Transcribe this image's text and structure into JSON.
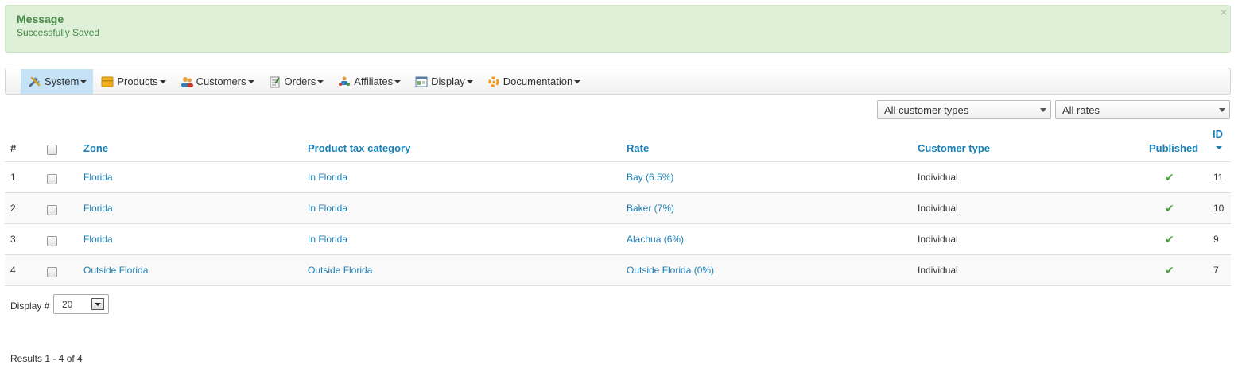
{
  "message": {
    "heading": "Message",
    "text": "Successfully Saved",
    "close": "×"
  },
  "menu": [
    {
      "label": "System",
      "icon": "tools-icon",
      "active": true
    },
    {
      "label": "Products",
      "icon": "box-icon"
    },
    {
      "label": "Customers",
      "icon": "users-icon"
    },
    {
      "label": "Orders",
      "icon": "orders-icon"
    },
    {
      "label": "Affiliates",
      "icon": "affiliates-icon"
    },
    {
      "label": "Display",
      "icon": "display-icon"
    },
    {
      "label": "Documentation",
      "icon": "documentation-icon"
    }
  ],
  "filters": {
    "customer_type": "All customer types",
    "rates": "All rates"
  },
  "table": {
    "headers": {
      "num": "#",
      "zone": "Zone",
      "product_tax_category": "Product tax category",
      "rate": "Rate",
      "customer_type": "Customer type",
      "published": "Published",
      "id": "ID"
    },
    "rows": [
      {
        "num": "1",
        "zone": "Florida",
        "category": "In Florida",
        "rate": "Bay (6.5%)",
        "customer_type": "Individual",
        "published": "✔",
        "id": "11"
      },
      {
        "num": "2",
        "zone": "Florida",
        "category": "In Florida",
        "rate": "Baker (7%)",
        "customer_type": "Individual",
        "published": "✔",
        "id": "10"
      },
      {
        "num": "3",
        "zone": "Florida",
        "category": "In Florida",
        "rate": "Alachua (6%)",
        "customer_type": "Individual",
        "published": "✔",
        "id": "9"
      },
      {
        "num": "4",
        "zone": "Outside Florida",
        "category": "Outside Florida",
        "rate": "Outside Florida (0%)",
        "customer_type": "Individual",
        "published": "✔",
        "id": "7"
      }
    ]
  },
  "footer": {
    "display_label": "Display #",
    "display_value": "20",
    "results": "Results 1 - 4 of 4"
  },
  "colors": {
    "link": "#1b7fb6",
    "success_bg": "#dff0d8",
    "success_text": "#468847",
    "published_check": "#4ba23a",
    "menu_active": "#c6e2f7"
  }
}
